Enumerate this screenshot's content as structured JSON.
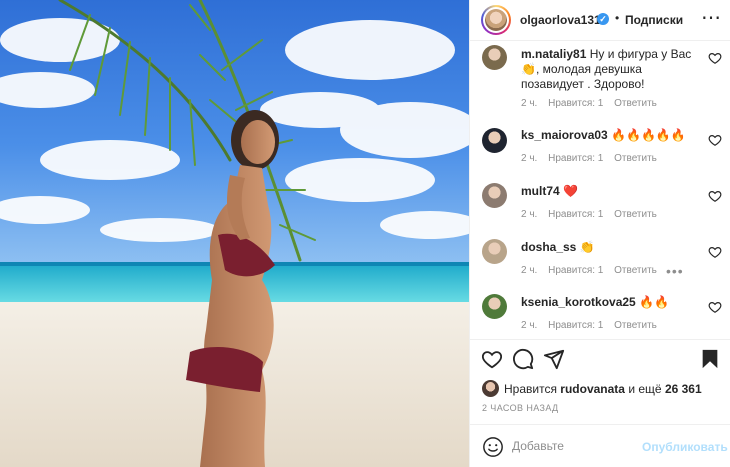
{
  "post": {
    "username": "olgaorlova1311",
    "separator": "•",
    "follow_label": "Подписки",
    "more_label": "⋯"
  },
  "comments": [
    {
      "user": "m.nataliy81",
      "text": "Ну и фигура у Вас👏, молодая девушка позавидует . Здорово!",
      "time": "2 ч.",
      "likes": "Нравится: 1",
      "reply": "Ответить",
      "avatar_color": "#7a6a4d"
    },
    {
      "user": "ks_maiorova03",
      "text": "🔥🔥🔥🔥🔥",
      "time": "2 ч.",
      "likes": "Нравится: 1",
      "reply": "Ответить",
      "avatar_color": "#1f2430"
    },
    {
      "user": "mult74",
      "text": "❤️",
      "time": "2 ч.",
      "likes": "Нравится: 1",
      "reply": "Ответить",
      "avatar_color": "#8c7b70"
    },
    {
      "user": "dosha_ss",
      "text": "👏",
      "time": "2 ч.",
      "likes": "Нравится: 1",
      "reply": "Ответить",
      "avatar_color": "#b8a48a",
      "options": "•••"
    },
    {
      "user": "ksenia_korotkova25",
      "text": "🔥🔥",
      "time": "2 ч.",
      "likes": "Нравится: 1",
      "reply": "Ответить",
      "avatar_color": "#4f7a3a"
    }
  ],
  "likes_bar": {
    "prefix": "Нравится",
    "user": "rudovanata",
    "mid": "и ещё",
    "count": "26 361"
  },
  "timestamp": "2 ЧАСОВ НАЗАД",
  "add_comment": {
    "placeholder": "Добавьте",
    "publish_label": "Опубликовать"
  },
  "icons": {
    "like": "heart-icon",
    "comment": "comment-bubble-icon",
    "share": "send-icon",
    "save": "bookmark-icon",
    "emoji": "smiley-icon",
    "verified": "verified-badge-icon"
  },
  "colors": {
    "link_blue": "#3897f0",
    "publish_disabled": "#b2dffc",
    "meta_gray": "#8e8e8e"
  }
}
